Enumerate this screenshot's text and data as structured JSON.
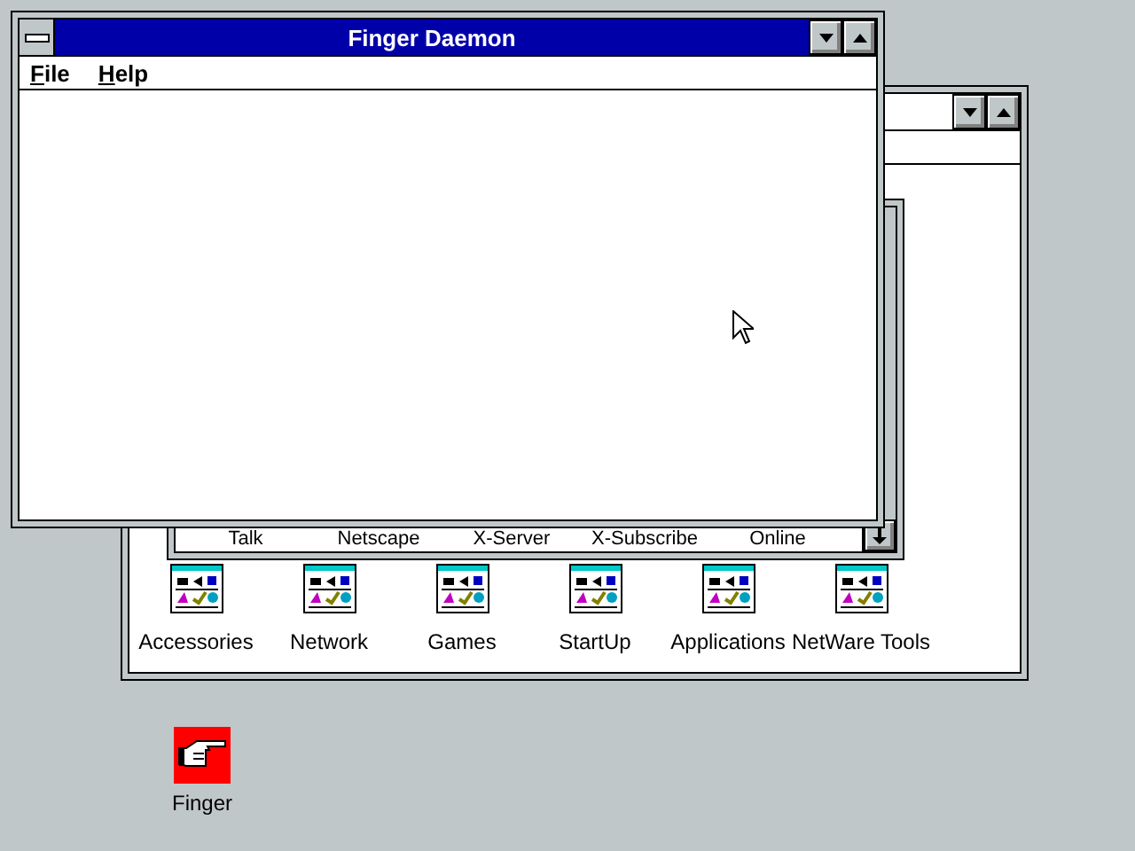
{
  "finger_window": {
    "title": "Finger Daemon",
    "menu": [
      "File",
      "Help"
    ]
  },
  "program_manager": {
    "group_window": {
      "items": [
        "Talk",
        "Netscape",
        "X-Server",
        "X-Subscribe",
        "Online"
      ]
    },
    "groups": [
      "Accessories",
      "Network",
      "Games",
      "StartUp",
      "Applications",
      "NetWare Tools"
    ]
  },
  "desktop_icons": [
    {
      "label": "Finger"
    }
  ]
}
